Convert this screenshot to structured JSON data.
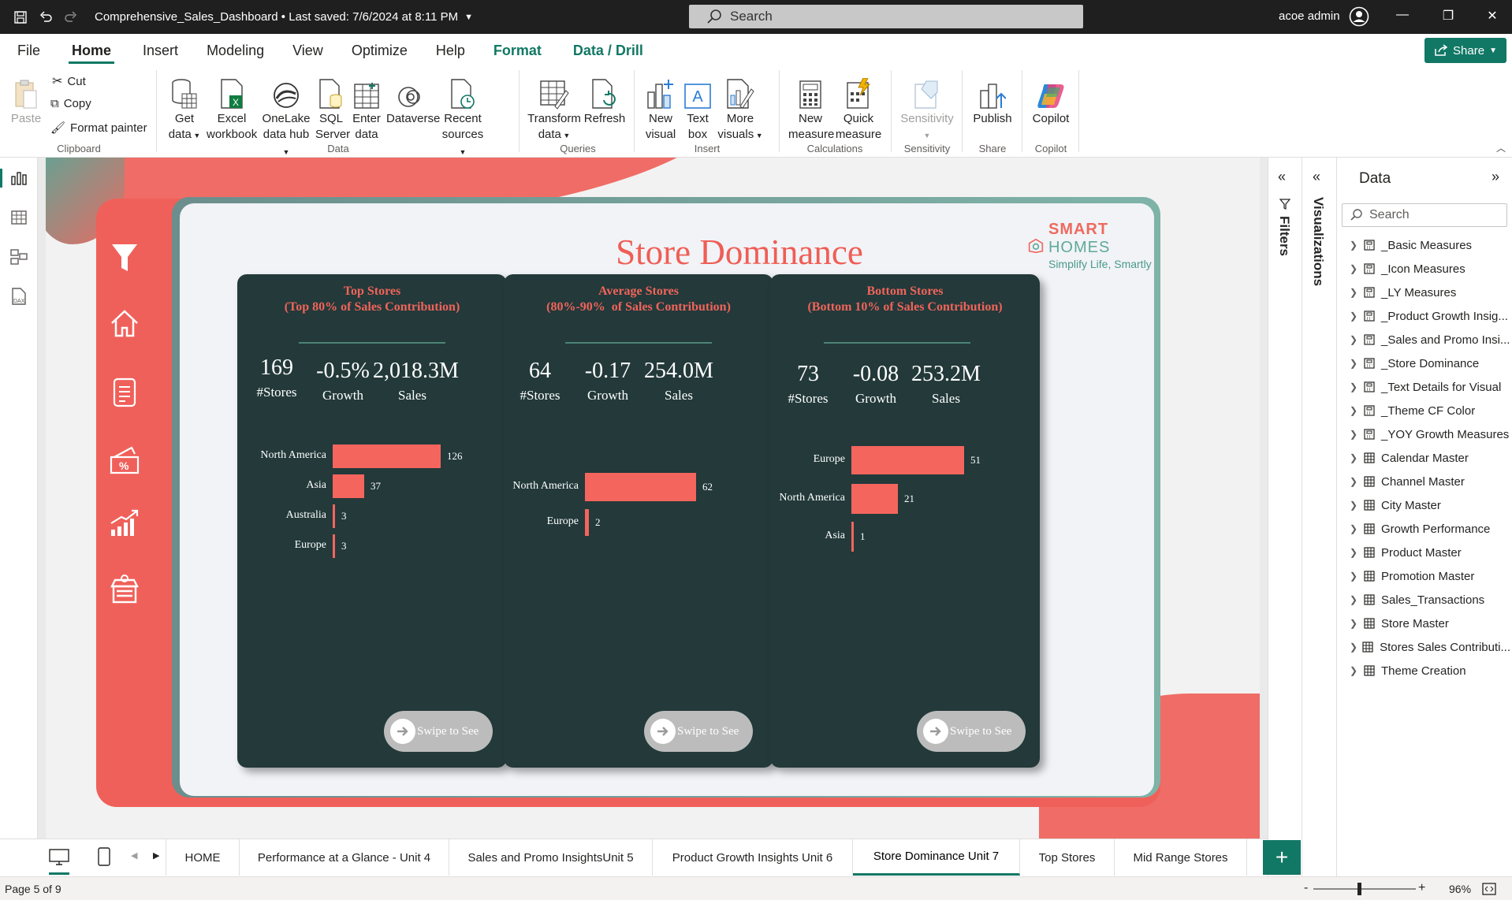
{
  "titlebar": {
    "document_title": "Comprehensive_Sales_Dashboard • Last saved: 7/6/2024 at 8:11 PM",
    "search_placeholder": "Search",
    "user_name": "acoe admin"
  },
  "ribbon_tabs": [
    "File",
    "Home",
    "Insert",
    "Modeling",
    "View",
    "Optimize",
    "Help",
    "Format",
    "Data / Drill"
  ],
  "active_tab": "Home",
  "share_label": "Share",
  "ribbon": {
    "clipboard": {
      "paste": "Paste",
      "cut": "Cut",
      "copy": "Copy",
      "format_painter": "Format painter",
      "label": "Clipboard"
    },
    "data": {
      "get_data": "Get data",
      "excel": "Excel workbook",
      "onelake": "OneLake data hub",
      "sql": "SQL Server",
      "enter": "Enter data",
      "dataverse": "Dataverse",
      "recent": "Recent sources",
      "label": "Data"
    },
    "queries": {
      "transform": "Transform data",
      "refresh": "Refresh",
      "label": "Queries"
    },
    "insert": {
      "new_visual": "New visual",
      "text_box": "Text box",
      "more_visuals": "More visuals",
      "label": "Insert"
    },
    "calculations": {
      "new_measure": "New measure",
      "quick_measure": "Quick measure",
      "label": "Calculations"
    },
    "sensitivity": {
      "btn": "Sensitivity",
      "label": "Sensitivity"
    },
    "share": {
      "publish": "Publish",
      "label": "Share"
    },
    "copilot": {
      "btn": "Copilot",
      "label": "Copilot"
    }
  },
  "report": {
    "title": "Store Dominance",
    "logo_brand_a": "SMART",
    "logo_brand_b": "HOMES",
    "logo_tagline": "Simplify Life, Smartly",
    "swipe_label": "Swipe to See",
    "cards": [
      {
        "title_line1": "Top Stores",
        "title_line2": "(Top 80% of Sales Contribution)",
        "stores": "169",
        "stores_label": "#Stores",
        "growth": "-0.5%",
        "growth_label": "Growth",
        "sales": "2,018.3M",
        "sales_label": "Sales"
      },
      {
        "title_line1": "Average Stores",
        "title_line2": "(80%-90%  of Sales Contribution)",
        "stores": "64",
        "stores_label": "#Stores",
        "growth": "-0.17",
        "growth_label": "Growth",
        "sales": "254.0M",
        "sales_label": "Sales"
      },
      {
        "title_line1": "Bottom Stores",
        "title_line2": "(Bottom 10% of Sales Contribution)",
        "stores": "73",
        "stores_label": "#Stores",
        "growth": "-0.08",
        "growth_label": "Growth",
        "sales": "253.2M",
        "sales_label": "Sales"
      }
    ]
  },
  "chart_data": [
    {
      "type": "bar",
      "orientation": "horizontal",
      "categories": [
        "North America",
        "Asia",
        "Australia",
        "Europe"
      ],
      "values": [
        126,
        37,
        3,
        3
      ]
    },
    {
      "type": "bar",
      "orientation": "horizontal",
      "categories": [
        "North America",
        "Europe"
      ],
      "values": [
        62,
        2
      ]
    },
    {
      "type": "bar",
      "orientation": "horizontal",
      "categories": [
        "Europe",
        "North America",
        "Asia"
      ],
      "values": [
        51,
        21,
        1
      ]
    }
  ],
  "panes": {
    "filters": "Filters",
    "visualizations": "Visualizations",
    "data_title": "Data",
    "data_search": "Search"
  },
  "data_tables": [
    {
      "name": "_Basic Measures"
    },
    {
      "name": "_Icon Measures"
    },
    {
      "name": "_LY Measures"
    },
    {
      "name": "_Product Growth Insig..."
    },
    {
      "name": "_Sales and Promo Insi..."
    },
    {
      "name": "_Store Dominance"
    },
    {
      "name": "_Text Details for Visual"
    },
    {
      "name": "_Theme CF Color"
    },
    {
      "name": "_YOY Growth Measures"
    },
    {
      "name": "Calendar Master"
    },
    {
      "name": "Channel Master"
    },
    {
      "name": "City Master"
    },
    {
      "name": "Growth Performance"
    },
    {
      "name": "Product Master"
    },
    {
      "name": "Promotion Master"
    },
    {
      "name": "Sales_Transactions"
    },
    {
      "name": "Store Master"
    },
    {
      "name": "Stores Sales Contributi..."
    },
    {
      "name": "Theme Creation"
    }
  ],
  "page_tabs": [
    "HOME",
    "Performance at a Glance - Unit 4",
    "Sales and Promo InsightsUnit 5",
    "Product Growth Insights Unit 6",
    "Store Dominance Unit 7",
    "Top Stores",
    "Mid Range Stores"
  ],
  "active_page": "Store Dominance Unit 7",
  "status": {
    "page_count": "Page 5 of 9",
    "zoom": "96%",
    "zoom_minus": "-",
    "zoom_plus": "+"
  },
  "colors": {
    "accent": "#117865",
    "coral": "#F0605A",
    "card_bg": "#23393A",
    "bar": "#F4655D"
  }
}
